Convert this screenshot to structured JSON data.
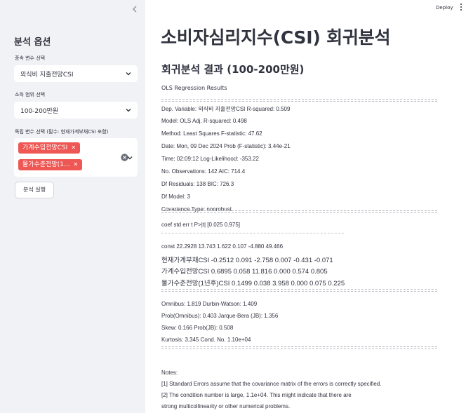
{
  "sidebar": {
    "collapse_icon": "chevron-left-icon",
    "title": "분석 옵션",
    "dependent": {
      "label": "종속 변수 선택",
      "value": "외식비 지출전망CSI"
    },
    "income": {
      "label": "소득 범위 선택",
      "value": "100-200만원"
    },
    "independent": {
      "label": "독립 변수 선택 (필수: 현재가계부채CSI 포함)",
      "tags": [
        "가계수입전망CSI",
        "물가수준전망(1..."
      ]
    },
    "run_label": "분석 실행"
  },
  "header": {
    "deploy_label": "Deploy",
    "menu_icon": "more-vertical-icon"
  },
  "main": {
    "title": "소비자심리지수(CSI) 회귀분석",
    "subtitle": "회귀분석 결과 (100-200만원)",
    "results_title": "OLS Regression Results",
    "stats": [
      "Dep. Variable: 외식비 지출전망CSI R-squared: 0.509",
      "Model: OLS Adj. R-squared: 0.498",
      "Method: Least Squares F-statistic: 47.62",
      "Date: Mon, 09 Dec 2024 Prob (F-statistic): 3.44e-21",
      "Time: 02:09:12 Log-Likelihood: -353.22",
      "No. Observations: 142 AIC: 714.4",
      "Df Residuals: 138 BIC: 726.3",
      "Df Model: 3",
      "Covariance Type: nonrobust"
    ],
    "coef_header": "coef std err t P>|t| [0.025 0.975]",
    "coef_rows": [
      "const 22.2928 13.743 1.622 0.107 -4.880 49.466",
      "현재가계부채CSI -0.2512 0.091 -2.758 0.007 -0.431 -0.071",
      "가계수입전망CSI 0.6895 0.058 11.816 0.000 0.574 0.805",
      "물가수준전망(1년후)CSI 0.1499 0.038 3.958 0.000 0.075 0.225"
    ],
    "diagnostics": [
      "Omnibus: 1.819 Durbin-Watson: 1.409",
      "Prob(Omnibus): 0.403 Jarque-Bera (JB): 1.356",
      "Skew: 0.166 Prob(JB): 0.508",
      "Kurtosis: 3.345 Cond. No. 1.10e+04"
    ],
    "notes": [
      "Notes:",
      "[1] Standard Errors assume that the covariance matrix of the errors is correctly specified.",
      "[2] The condition number is large, 1.1e+04. This might indicate that there are",
      "strong multicollinearity or other numerical problems."
    ]
  }
}
